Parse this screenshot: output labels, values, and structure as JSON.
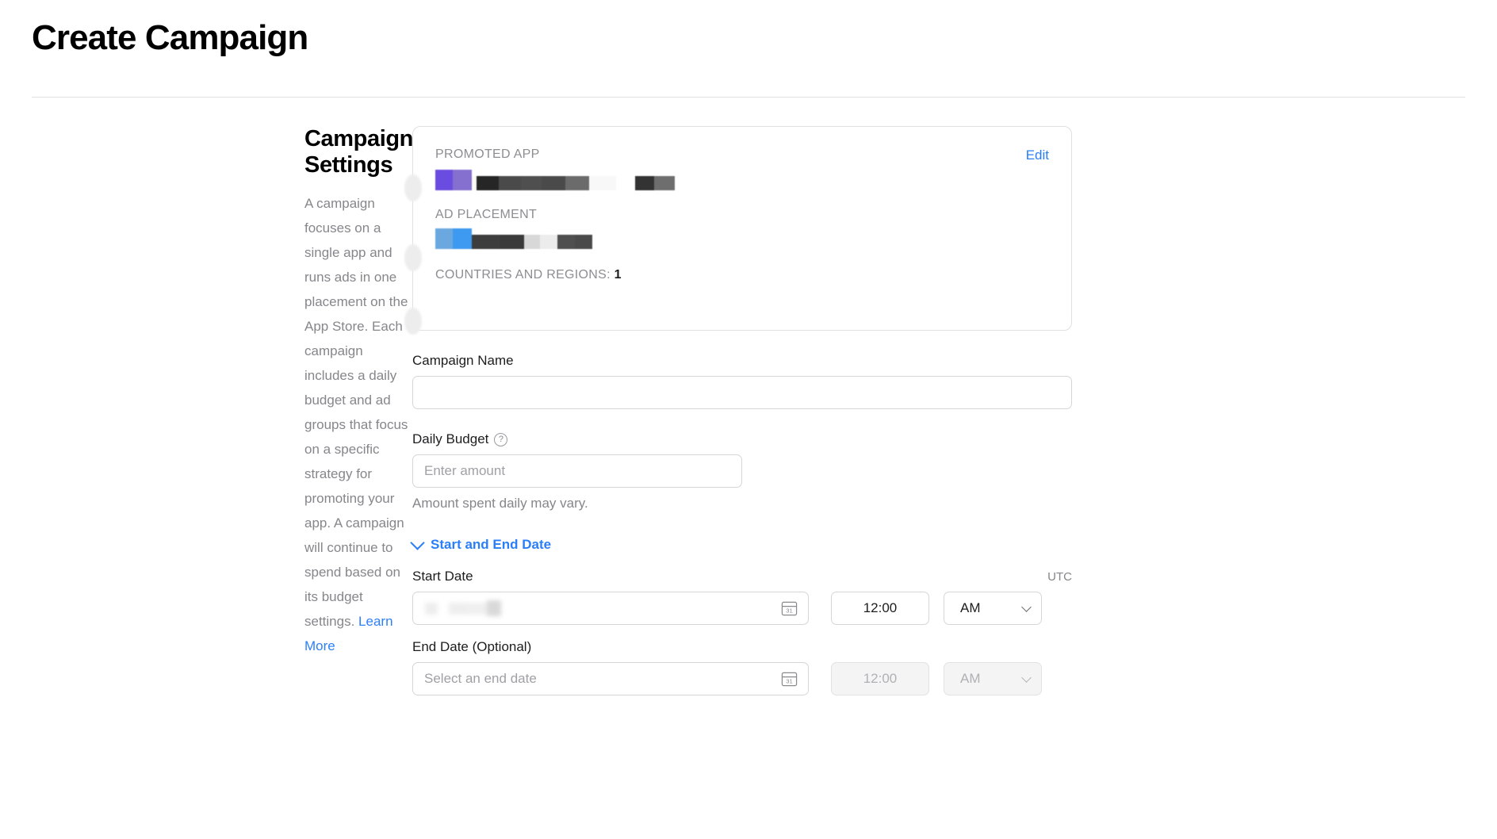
{
  "page": {
    "title": "Create Campaign"
  },
  "left": {
    "section_title": "Campaign Settings",
    "description": "A campaign focuses on a single app and runs ads in one placement on the App Store. Each campaign includes a daily budget and ad groups that focus on a specific strategy for promoting your app. A campaign will continue to spend based on its budget settings. ",
    "learn_more": "Learn More"
  },
  "summary_card": {
    "edit_label": "Edit",
    "promoted_app_label": "PROMOTED APP",
    "promoted_app_value": "",
    "ad_placement_label": "AD PLACEMENT",
    "ad_placement_value": "",
    "countries_label": "COUNTRIES AND REGIONS:",
    "countries_count": "1"
  },
  "form": {
    "campaign_name_label": "Campaign Name",
    "campaign_name_value": "",
    "campaign_name_placeholder": "",
    "daily_budget_label": "Daily Budget",
    "daily_budget_help_icon": "help-circle-icon",
    "daily_budget_placeholder": "Enter amount",
    "daily_budget_value": "",
    "daily_budget_hint": "Amount spent daily may vary.",
    "date_disclosure_label": "Start and End Date",
    "timezone_label": "UTC",
    "start_date": {
      "label": "Start Date",
      "value": "",
      "placeholder": "",
      "time_value": "12:00",
      "meridiem_value": "AM",
      "calendar_icon": "calendar-31-icon"
    },
    "end_date": {
      "label": "End Date (Optional)",
      "value": "",
      "placeholder": "Select an end date",
      "time_value": "12:00",
      "meridiem_value": "AM",
      "calendar_icon": "calendar-31-icon"
    }
  },
  "colors": {
    "link_blue": "#2a7ef8",
    "text_primary": "#1d1d1f",
    "text_secondary": "#86868b",
    "border": "#d6d6d6",
    "disabled_bg": "#f4f4f5"
  }
}
